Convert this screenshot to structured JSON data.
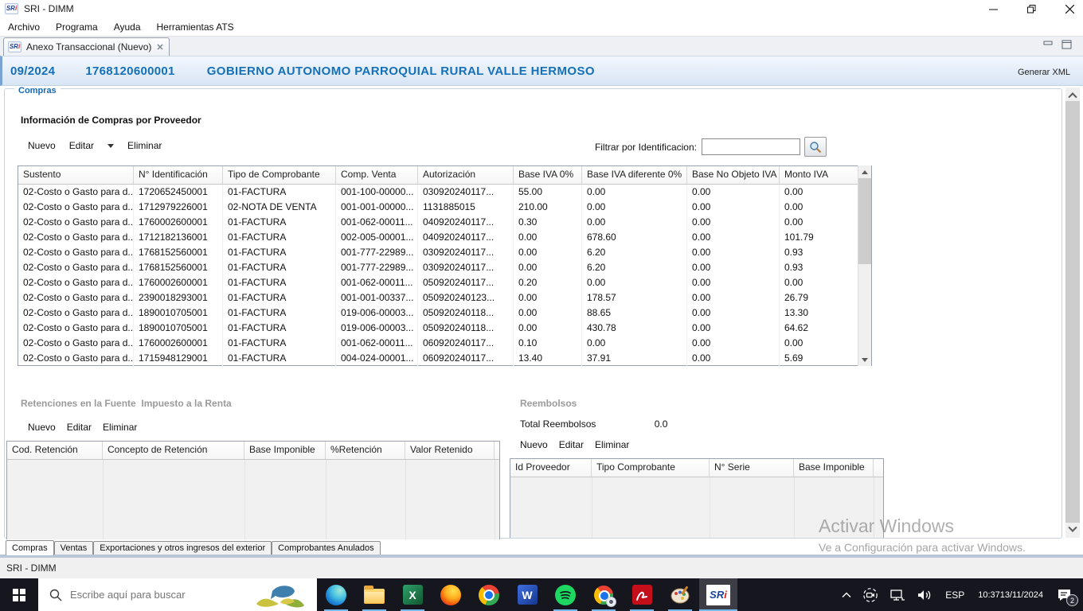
{
  "window": {
    "title": "SRI - DIMM",
    "menu": [
      "Archivo",
      "Programa",
      "Ayuda",
      "Herramientas ATS"
    ],
    "controls": [
      "minimize",
      "restore",
      "close"
    ]
  },
  "editor_tab": {
    "label": "Anexo Transaccional (Nuevo)"
  },
  "header": {
    "period": "09/2024",
    "ruc": "1768120600001",
    "taxpayer": "GOBIERNO AUTONOMO PARROQUIAL RURAL VALLE HERMOSO",
    "generar_xml": "Generar XML"
  },
  "toolbar_labels": {
    "nuevo": "Nuevo",
    "editar": "Editar",
    "eliminar": "Eliminar"
  },
  "compras": {
    "group_label": "Compras",
    "section_title": "Información de Compras por Proveedor",
    "filter_label": "Filtrar por Identificacion:",
    "filter_value": "",
    "table": {
      "columns": [
        "Sustento",
        "N° Identificación",
        "Tipo de Comprobante",
        "Comp. Venta",
        "Autorización",
        "Base IVA 0%",
        "Base IVA diferente 0%",
        "Base No Objeto IVA",
        "Monto IVA"
      ],
      "rows": [
        [
          "02-Costo o Gasto para d...",
          "1720652450001",
          "01-FACTURA",
          "001-100-00000...",
          "030920240117...",
          "55.00",
          "0.00",
          "0.00",
          "0.00"
        ],
        [
          "02-Costo o Gasto para d...",
          "1712979226001",
          "02-NOTA DE VENTA",
          "001-001-00000...",
          "1131885015",
          "210.00",
          "0.00",
          "0.00",
          "0.00"
        ],
        [
          "02-Costo o Gasto para d...",
          "1760002600001",
          "01-FACTURA",
          "001-062-00011...",
          "040920240117...",
          "0.30",
          "0.00",
          "0.00",
          "0.00"
        ],
        [
          "02-Costo o Gasto para d...",
          "1712182136001",
          "01-FACTURA",
          "002-005-00001...",
          "040920240117...",
          "0.00",
          "678.60",
          "0.00",
          "101.79"
        ],
        [
          "02-Costo o Gasto para d...",
          "1768152560001",
          "01-FACTURA",
          "001-777-22989...",
          "030920240117...",
          "0.00",
          "6.20",
          "0.00",
          "0.93"
        ],
        [
          "02-Costo o Gasto para d...",
          "1768152560001",
          "01-FACTURA",
          "001-777-22989...",
          "030920240117...",
          "0.00",
          "6.20",
          "0.00",
          "0.93"
        ],
        [
          "02-Costo o Gasto para d...",
          "1760002600001",
          "01-FACTURA",
          "001-062-00011...",
          "050920240117...",
          "0.20",
          "0.00",
          "0.00",
          "0.00"
        ],
        [
          "02-Costo o Gasto para d...",
          "2390018293001",
          "01-FACTURA",
          "001-001-00337...",
          "050920240123...",
          "0.00",
          "178.57",
          "0.00",
          "26.79"
        ],
        [
          "02-Costo o Gasto para d...",
          "1890010705001",
          "01-FACTURA",
          "019-006-00003...",
          "050920240118...",
          "0.00",
          "88.65",
          "0.00",
          "13.30"
        ],
        [
          "02-Costo o Gasto para d...",
          "1890010705001",
          "01-FACTURA",
          "019-006-00003...",
          "050920240118...",
          "0.00",
          "430.78",
          "0.00",
          "64.62"
        ],
        [
          "02-Costo o Gasto para d...",
          "1760002600001",
          "01-FACTURA",
          "001-062-00011...",
          "060920240117...",
          "0.10",
          "0.00",
          "0.00",
          "0.00"
        ],
        [
          "02-Costo o Gasto para d...",
          "1715948129001",
          "01-FACTURA",
          "004-024-00001...",
          "060920240117...",
          "13.40",
          "37.91",
          "0.00",
          "5.69"
        ]
      ]
    }
  },
  "retenciones": {
    "section_title": "Retenciones en la Fuente  Impuesto a la Renta",
    "table": {
      "columns": [
        "Cod. Retención",
        "Concepto de Retención",
        "Base Imponible",
        "%Retención",
        "Valor Retenido"
      ],
      "rows": []
    }
  },
  "reembolsos": {
    "section_title": "Reembolsos",
    "total_label": "Total Reembolsos",
    "total_value": "0.0",
    "table": {
      "columns": [
        "Id Proveedor",
        "Tipo Comprobante",
        "N° Serie",
        "Base Imponible"
      ],
      "rows": []
    }
  },
  "bottom_tabs": [
    "Compras",
    "Ventas",
    "Exportaciones y otros ingresos del exterior",
    "Comprobantes Anulados"
  ],
  "status_bar": {
    "text": "SRI - DIMM"
  },
  "taskbar": {
    "search_placeholder": "Escribe aquí para buscar",
    "apps": [
      "edge",
      "file-explorer",
      "excel",
      "firefox",
      "chrome",
      "word",
      "spotify",
      "chrome-app",
      "acrobat-reader",
      "paint",
      "sri-dimm"
    ],
    "language": "ESP",
    "time": "10:37",
    "date": "13/11/2024",
    "notification_count": "2"
  },
  "watermark": {
    "line1": "Activar Windows",
    "line2": "Ve a Configuración para activar Windows."
  },
  "colors": {
    "accent_blue": "#1470b8",
    "taskbar": "#16161e",
    "underline": "#76b9ed"
  }
}
